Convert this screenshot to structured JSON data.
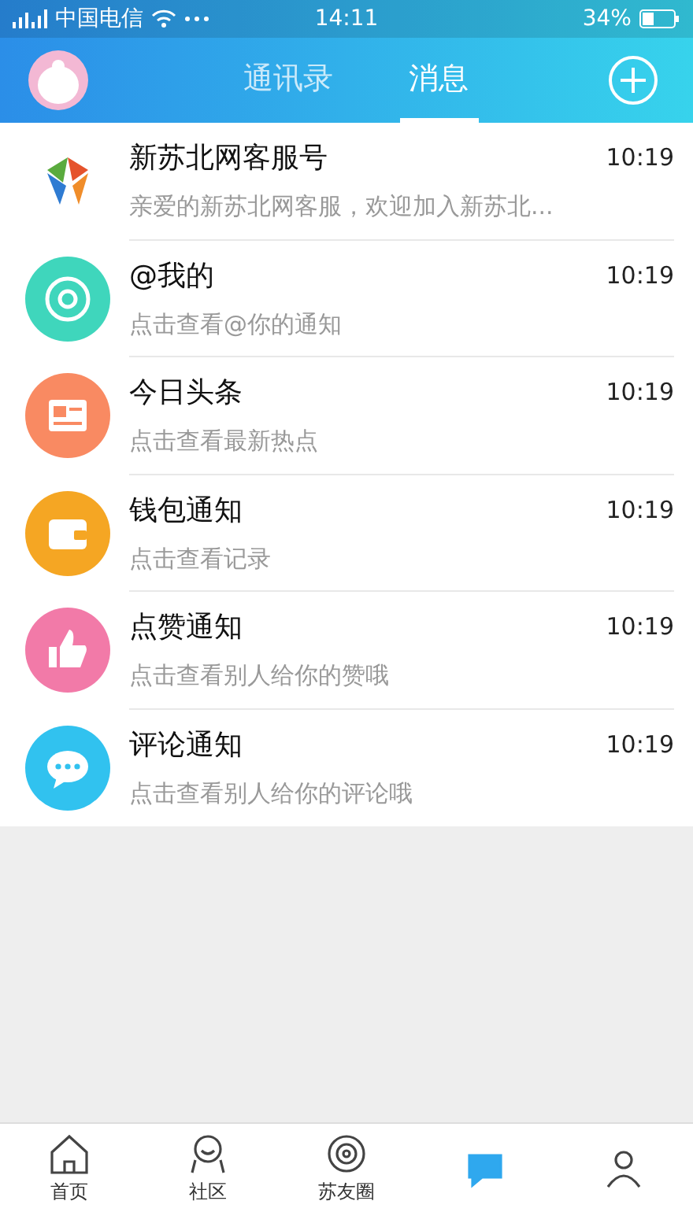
{
  "status_bar": {
    "carrier": "中国电信",
    "time": "14:11",
    "battery": "34%"
  },
  "header": {
    "tabs": [
      {
        "label": "通讯录",
        "selected": false
      },
      {
        "label": "消息",
        "selected": true
      }
    ]
  },
  "messages": [
    {
      "kind": "logo",
      "title": "新苏北网客服号",
      "preview": "亲爱的新苏北网客服，欢迎加入新苏北...",
      "time": "10:19"
    },
    {
      "kind": "at",
      "color": "#3fd6bc",
      "title": "@我的",
      "preview": "点击查看@你的通知",
      "time": "10:19"
    },
    {
      "kind": "news",
      "color": "#f98a62",
      "title": "今日头条",
      "preview": "点击查看最新热点",
      "time": "10:19"
    },
    {
      "kind": "wallet",
      "color": "#f5a623",
      "title": "钱包通知",
      "preview": "点击查看记录",
      "time": "10:19"
    },
    {
      "kind": "like",
      "color": "#f27aa8",
      "title": "点赞通知",
      "preview": "点击查看别人给你的赞哦",
      "time": "10:19"
    },
    {
      "kind": "comment",
      "color": "#31c2ef",
      "title": "评论通知",
      "preview": "点击查看别人给你的评论哦",
      "time": "10:19"
    }
  ],
  "bottom_nav": [
    {
      "kind": "home",
      "label": "首页",
      "selected": false
    },
    {
      "kind": "community",
      "label": "社区",
      "selected": false
    },
    {
      "kind": "circle",
      "label": "苏友圈",
      "selected": false
    },
    {
      "kind": "message",
      "selected": true
    },
    {
      "kind": "profile",
      "selected": false
    }
  ]
}
